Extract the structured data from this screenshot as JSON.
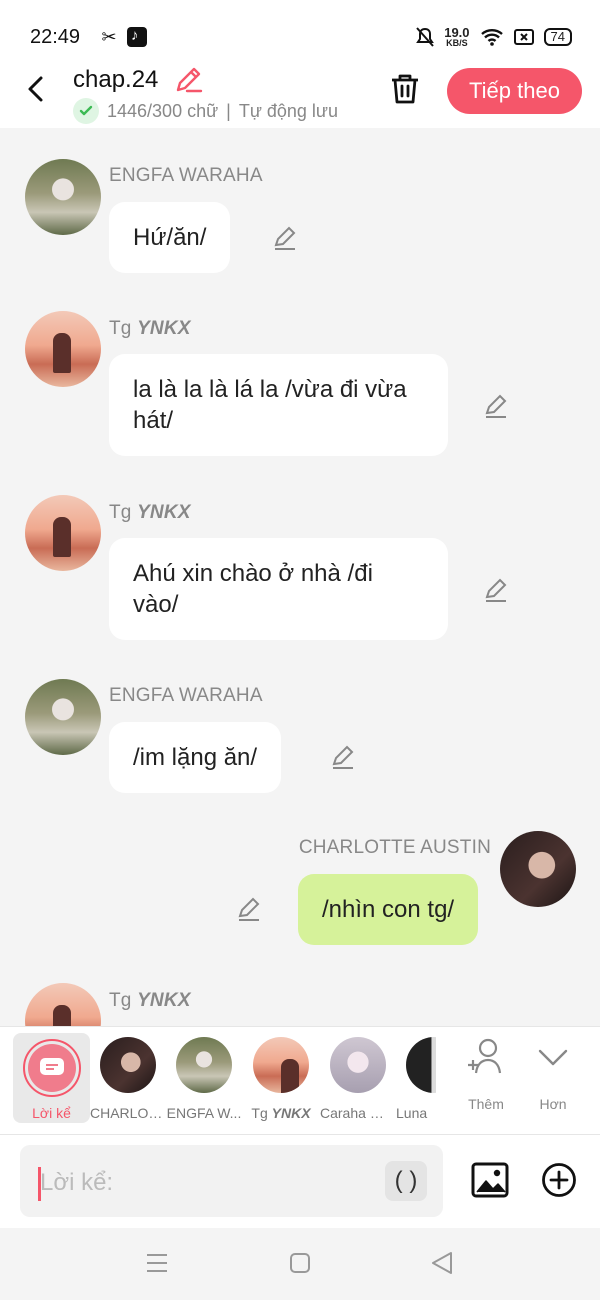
{
  "status_bar": {
    "time": "22:49",
    "network_speed": "19.0",
    "network_unit": "KB/S",
    "battery": "74"
  },
  "header": {
    "title": "chap.24",
    "word_count": "1446/300 chữ",
    "separator": "|",
    "autosave": "Tự động lưu",
    "next_label": "Tiếp theo"
  },
  "messages": [
    {
      "sender": "ENGFA WARAHA",
      "text": "Hứ/ăn/",
      "side": "left"
    },
    {
      "sender_prefix": "Tg",
      "sender_emph": "YNKX",
      "text": "la là la là lá la /vừa đi vừa hát/",
      "side": "left"
    },
    {
      "sender_prefix": "Tg",
      "sender_emph": "YNKX",
      "text": "Ahú xin chào ở nhà /đi vào/",
      "side": "left"
    },
    {
      "sender": "ENGFA WARAHA",
      "text": "/im lặng ăn/",
      "side": "left"
    },
    {
      "sender": "CHARLOTTE AUSTIN",
      "text": "/nhìn con tg/",
      "side": "right"
    },
    {
      "sender_prefix": "Tg",
      "sender_emph": "YNKX",
      "text": "",
      "side": "left"
    }
  ],
  "characters": {
    "narrator_label": "Lời kể",
    "items": [
      {
        "label": "CHARLOT..."
      },
      {
        "label": "ENGFA W..."
      },
      {
        "label_prefix": "Tg",
        "label_emph": "YNKX"
      },
      {
        "label": "Caraha Wi..."
      },
      {
        "label": "Luna"
      }
    ],
    "add_label": "Thêm",
    "more_label": "Hơn"
  },
  "input": {
    "placeholder": "Lời kể:",
    "paren_label": "( )"
  },
  "colors": {
    "accent": "#f5566a",
    "right_bubble": "#d6f29a",
    "background": "#f4f4f4"
  }
}
